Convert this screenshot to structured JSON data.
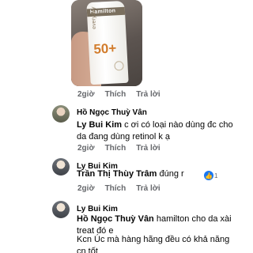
{
  "photo": {
    "brand": "Hamilton",
    "line": "everyday",
    "spf": "50+"
  },
  "actions_label": {
    "time": "2giờ",
    "like": "Thích",
    "reply": "Trả lời"
  },
  "comments": [
    {
      "author": "Hồ Ngọc Thuỳ Vân",
      "mention": "Ly Bui Kim",
      "text": " c ơi có loại nào dùng đc cho da đang dùng retinol k ạ",
      "time": "2giờ",
      "like": "Thích",
      "reply": "Trả lời"
    },
    {
      "author": "Ly Bui Kim",
      "mention": "Trần Thị Thùy Trâm",
      "text": " đúng r",
      "reaction_count": "1",
      "time": "2giờ",
      "like": "Thích",
      "reply": "Trả lời"
    },
    {
      "author": "Ly Bui Kim",
      "mention": "Hồ Ngọc Thuỳ Vân",
      "text": " hamilton cho da xài treat đó e",
      "text2": "Kcn Úc mà hàng hãng đều có khả năng cn tốt"
    }
  ],
  "colors": {
    "like_badge": "#1877f2",
    "meta_text": "#65676b"
  }
}
